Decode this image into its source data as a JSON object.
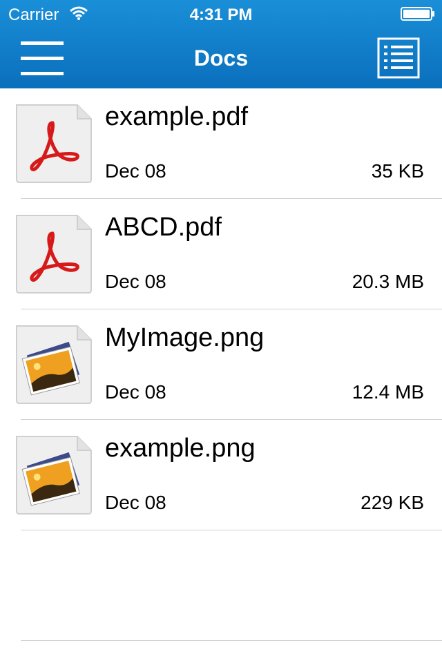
{
  "status_bar": {
    "carrier": "Carrier",
    "time": "4:31 PM"
  },
  "nav": {
    "title": "Docs"
  },
  "files": [
    {
      "name": "example.pdf",
      "date": "Dec 08",
      "size": "35 KB",
      "icon": "pdf-icon"
    },
    {
      "name": "ABCD.pdf",
      "date": "Dec 08",
      "size": "20.3 MB",
      "icon": "pdf-icon"
    },
    {
      "name": "MyImage.png",
      "date": "Dec 08",
      "size": "12.4 MB",
      "icon": "image-icon"
    },
    {
      "name": "example.png",
      "date": "Dec 08",
      "size": "229 KB",
      "icon": "image-icon"
    }
  ],
  "colors": {
    "nav_background": "#0a7cc9",
    "pdf_red": "#d61a1a",
    "separator": "#d0d0d0"
  }
}
